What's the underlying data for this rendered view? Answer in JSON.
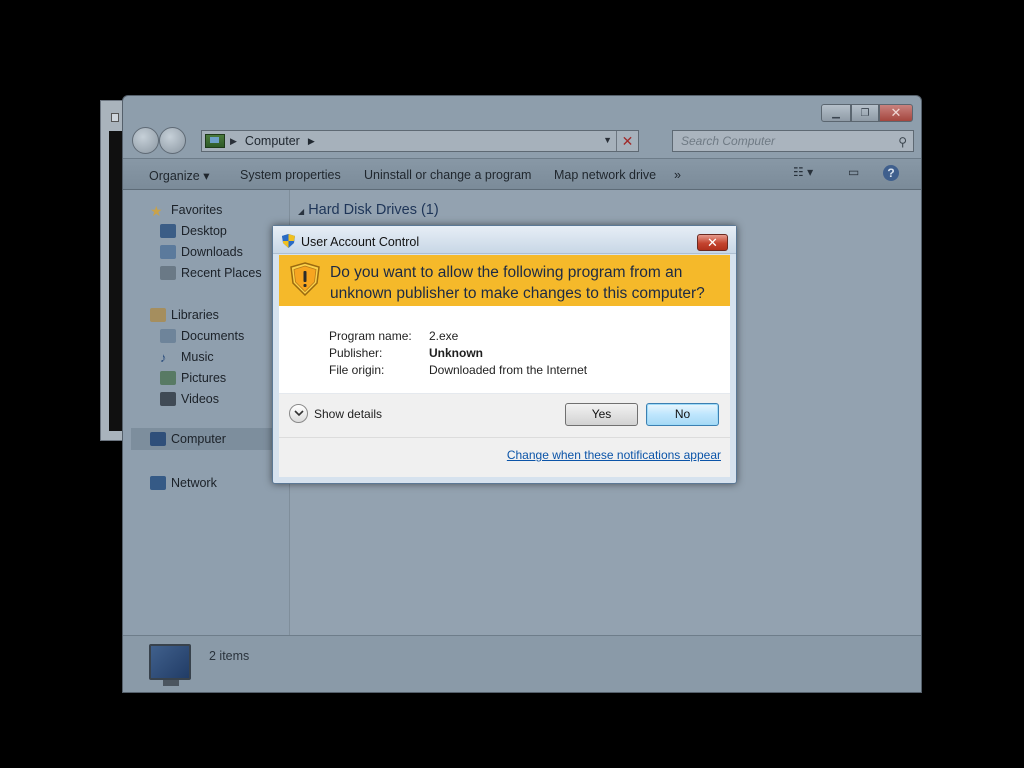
{
  "explorer": {
    "address": {
      "crumb": "Computer"
    },
    "search": {
      "placeholder": "Search Computer"
    },
    "toolbar": {
      "organize": "Organize ▾",
      "system_properties": "System properties",
      "uninstall": "Uninstall or change a program",
      "map_drive": "Map network drive",
      "more": "»"
    },
    "nav": {
      "favorites": "Favorites",
      "desktop": "Desktop",
      "downloads": "Downloads",
      "recent_places": "Recent Places",
      "libraries": "Libraries",
      "documents": "Documents",
      "music": "Music",
      "pictures": "Pictures",
      "videos": "Videos",
      "computer": "Computer",
      "network": "Network"
    },
    "group_header": "Hard Disk Drives (1)",
    "details": {
      "count": "2 items"
    }
  },
  "uac": {
    "title": "User Account Control",
    "question": "Do you want to allow the following program from an unknown publisher to make changes to this computer?",
    "program_name_label": "Program name:",
    "program_name_value": "2.exe",
    "publisher_label": "Publisher:",
    "publisher_value": "Unknown",
    "file_origin_label": "File origin:",
    "file_origin_value": "Downloaded from the Internet",
    "show_details": "Show details",
    "yes": "Yes",
    "no": "No",
    "change_link": "Change when these notifications appear",
    "colors": {
      "banner": "#f5b92a",
      "link": "#0b54a8"
    }
  }
}
